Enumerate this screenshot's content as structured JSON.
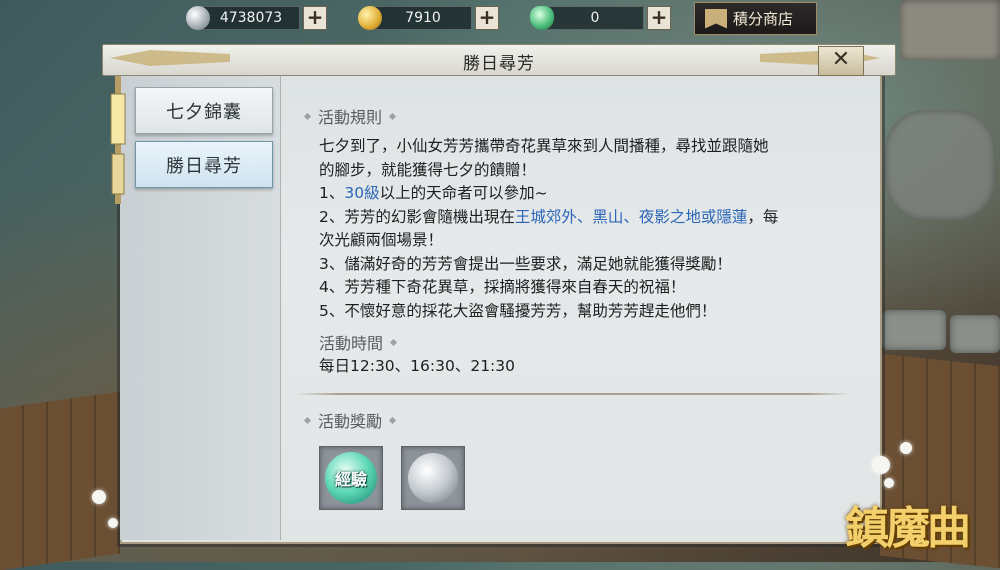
{
  "currencies": [
    {
      "icon": "silver-coin-icon",
      "value": "4738073"
    },
    {
      "icon": "gold-coin-icon",
      "value": "7910"
    },
    {
      "icon": "jade-ingot-icon",
      "value": "0"
    }
  ],
  "shop_label": "積分商店",
  "window_title": "勝日尋芳",
  "close_glyph": "✕",
  "tabs": [
    {
      "label": "七夕錦囊"
    },
    {
      "label": "勝日尋芳"
    }
  ],
  "rules": {
    "heading": "活動規則",
    "intro_1": "七夕到了，小仙女芳芳攜帶奇花異草來到人間播種，尋找並跟隨她",
    "intro_2": "的腳步，就能獲得七夕的饋贈！",
    "r1_prefix": "1、",
    "r1_hl": "30級",
    "r1_rest": "以上的天命者可以參加~",
    "r2_prefix": "2、芳芳的幻影會隨機出現在",
    "r2_hl": "王城郊外、黑山、夜影之地或隱蓮",
    "r2_rest": "，每",
    "r2_line2": "次光顧兩個場景！",
    "r3": "3、儲滿好奇的芳芳會提出一些要求，滿足她就能獲得獎勵！",
    "r4": "4、芳芳種下奇花異草，採摘將獲得來自春天的祝福！",
    "r5": "5、不懷好意的採花大盜會騷擾芳芳，幫助芳芳趕走他們！"
  },
  "time": {
    "heading": "活動時間",
    "value": "每日12:30、16:30、21:30"
  },
  "rewards": {
    "heading": "活動獎勵",
    "items": [
      {
        "icon": "experience-orb-icon",
        "label": "經驗"
      },
      {
        "icon": "silver-coin-icon"
      }
    ]
  },
  "logo_text": "鎮魔曲",
  "colors": {
    "highlight": "#2b66b8",
    "active_tab": "#cfe3ef"
  }
}
